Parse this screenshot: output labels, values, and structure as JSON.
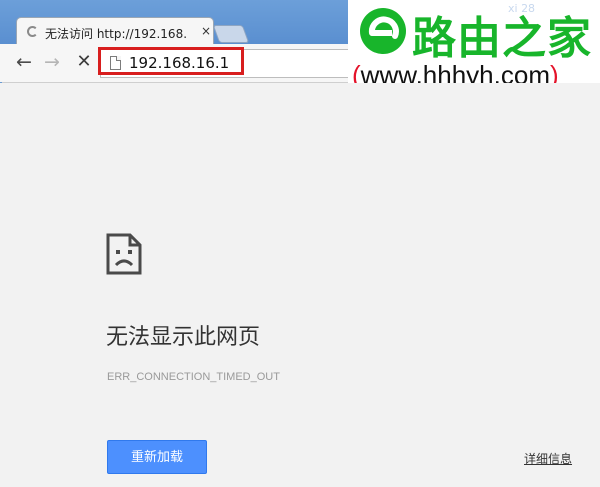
{
  "browser": {
    "tab": {
      "title": "无法访问 http://192.168.",
      "close_glyph": "×"
    },
    "nav": {
      "back": "←",
      "forward": "→",
      "stop": "✕"
    },
    "omnibox": {
      "url": "192.168.16.1"
    }
  },
  "watermark": {
    "name": "路由之家",
    "url_open": "(",
    "url_body": "www.hhhyh.com",
    "url_close": ")",
    "corner_badge": "xi 28",
    "brand_color": "#18b52b"
  },
  "error_page": {
    "title": "无法显示此网页",
    "error_code": "ERR_CONNECTION_TIMED_OUT",
    "reload_label": "重新加载",
    "details_label": "详细信息",
    "button_color": "#4d90fe"
  }
}
